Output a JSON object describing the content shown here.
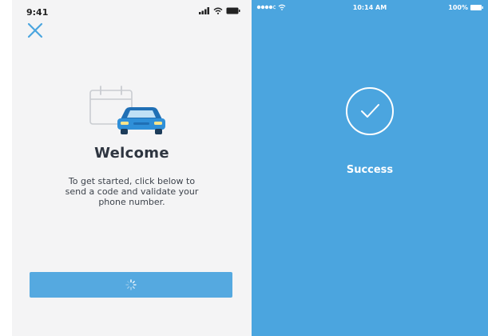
{
  "left_screen": {
    "status_bar": {
      "time": "9:41"
    },
    "close_icon": "close-x-icon",
    "illustration": "calendar-car-icon",
    "title": "Welcome",
    "body_lines": [
      "To get started, click below to",
      "send a code and validate your",
      "phone number."
    ],
    "send_button": {
      "state": "loading",
      "icon": "spinner-icon"
    },
    "colors": {
      "background": "#f4f4f5",
      "accent": "#55a9e0",
      "title": "#2e3540"
    }
  },
  "right_screen": {
    "status_bar": {
      "time": "10:14 AM",
      "battery": "100%"
    },
    "success_icon": "check-circle-icon",
    "message": "Success",
    "colors": {
      "background": "#4ba5df",
      "foreground": "#ffffff"
    }
  }
}
